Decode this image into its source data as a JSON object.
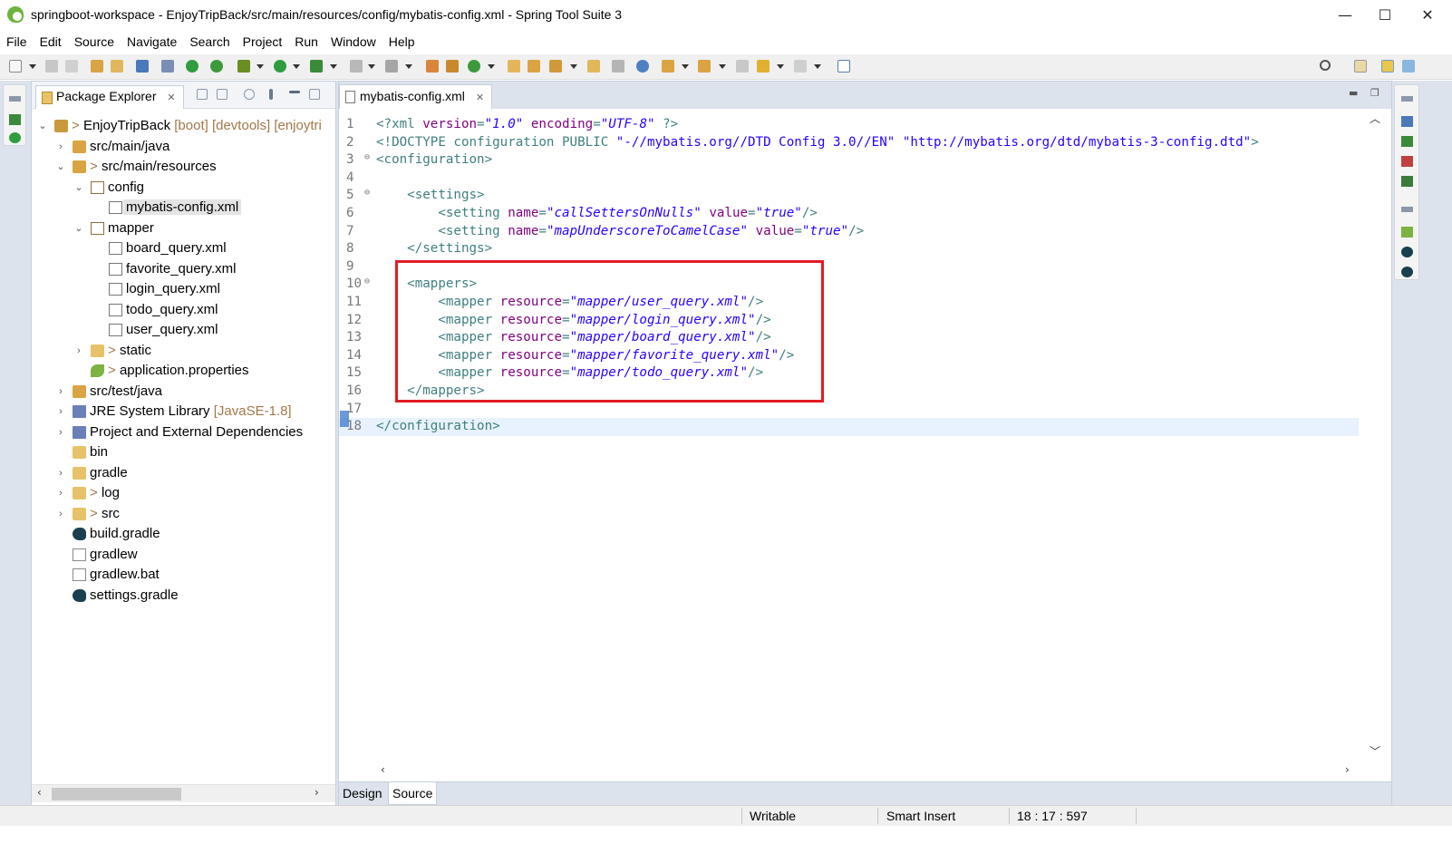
{
  "window": {
    "title": "springboot-workspace - EnjoyTripBack/src/main/resources/config/mybatis-config.xml - Spring Tool Suite 3",
    "minimize_glyph": "—",
    "maximize_glyph": "☐",
    "close_glyph": "✕"
  },
  "menu": [
    "File",
    "Edit",
    "Source",
    "Navigate",
    "Search",
    "Project",
    "Run",
    "Window",
    "Help"
  ],
  "explorer": {
    "title": "Package Explorer",
    "close_glyph": "✕",
    "tree": [
      {
        "label": "EnjoyTripBack",
        "decor": "[boot] [devtools] [enjoytri",
        "prefix": ">",
        "icon": "project-icon"
      },
      {
        "label": "src/main/java",
        "icon": "source-folder-icon"
      },
      {
        "label": "src/main/resources",
        "prefix": ">",
        "icon": "source-folder-icon"
      },
      {
        "label": "config",
        "icon": "package-icon"
      },
      {
        "label": "mybatis-config.xml",
        "icon": "xml-file-icon"
      },
      {
        "label": "mapper",
        "icon": "package-icon"
      },
      {
        "label": "board_query.xml",
        "icon": "xml-file-icon"
      },
      {
        "label": "favorite_query.xml",
        "icon": "xml-file-icon"
      },
      {
        "label": "login_query.xml",
        "icon": "xml-file-icon"
      },
      {
        "label": "todo_query.xml",
        "icon": "xml-file-icon"
      },
      {
        "label": "user_query.xml",
        "icon": "xml-file-icon"
      },
      {
        "label": "static",
        "prefix": ">",
        "icon": "folder-icon"
      },
      {
        "label": "application.properties",
        "prefix": ">",
        "icon": "properties-file-icon"
      },
      {
        "label": "src/test/java",
        "icon": "source-folder-icon"
      },
      {
        "label": "JRE System Library",
        "decor": "[JavaSE-1.8]",
        "icon": "library-icon"
      },
      {
        "label": "Project and External Dependencies",
        "icon": "library-icon"
      },
      {
        "label": "bin",
        "icon": "folder-icon"
      },
      {
        "label": "gradle",
        "icon": "folder-icon"
      },
      {
        "label": "log",
        "prefix": ">",
        "icon": "folder-icon"
      },
      {
        "label": "src",
        "prefix": ">",
        "icon": "folder-icon"
      },
      {
        "label": "build.gradle",
        "icon": "gradle-file-icon"
      },
      {
        "label": "gradlew",
        "icon": "file-icon"
      },
      {
        "label": "gradlew.bat",
        "icon": "file-icon"
      },
      {
        "label": "settings.gradle",
        "icon": "gradle-file-icon"
      }
    ]
  },
  "editor": {
    "tab_label": "mybatis-config.xml",
    "close_glyph": "✕",
    "line_numbers": [
      "1",
      "2",
      "3",
      "4",
      "5",
      "6",
      "7",
      "8",
      "9",
      "10",
      "11",
      "12",
      "13",
      "14",
      "15",
      "16",
      "17",
      "18"
    ],
    "lines": [
      [
        [
          "decl",
          "<?xml "
        ],
        [
          "attr",
          "version"
        ],
        [
          "decl",
          "="
        ],
        [
          "val",
          "\"1.0\""
        ],
        [
          "decl",
          " "
        ],
        [
          "attr",
          "encoding"
        ],
        [
          "decl",
          "="
        ],
        [
          "val",
          "\"UTF-8\""
        ],
        [
          "decl",
          " ?>"
        ]
      ],
      [
        [
          "decl",
          "<!DOCTYPE configuration "
        ],
        [
          "tag",
          "PUBLIC "
        ],
        [
          "str",
          "\"-//mybatis.org//DTD Config 3.0//EN\" \"http://mybatis.org/dtd/mybatis-3-config.dtd\""
        ],
        [
          "decl",
          ">"
        ]
      ],
      [
        [
          "tag",
          "<configuration>"
        ]
      ],
      [],
      [
        [
          "tag",
          "    <settings>"
        ]
      ],
      [
        [
          "tag",
          "        <setting "
        ],
        [
          "attr",
          "name"
        ],
        [
          "tag",
          "="
        ],
        [
          "val",
          "\"callSettersOnNulls\""
        ],
        [
          "tag",
          " "
        ],
        [
          "attr",
          "value"
        ],
        [
          "tag",
          "="
        ],
        [
          "val",
          "\"true\""
        ],
        [
          "tag",
          "/>"
        ]
      ],
      [
        [
          "tag",
          "        <setting "
        ],
        [
          "attr",
          "name"
        ],
        [
          "tag",
          "="
        ],
        [
          "val",
          "\"mapUnderscoreToCamelCase\""
        ],
        [
          "tag",
          " "
        ],
        [
          "attr",
          "value"
        ],
        [
          "tag",
          "="
        ],
        [
          "val",
          "\"true\""
        ],
        [
          "tag",
          "/>"
        ]
      ],
      [
        [
          "tag",
          "    </settings>"
        ]
      ],
      [],
      [
        [
          "tag",
          "    <mappers>"
        ]
      ],
      [
        [
          "tag",
          "        <mapper "
        ],
        [
          "attr",
          "resource"
        ],
        [
          "tag",
          "="
        ],
        [
          "val",
          "\"mapper/user_query.xml\""
        ],
        [
          "tag",
          "/>"
        ]
      ],
      [
        [
          "tag",
          "        <mapper "
        ],
        [
          "attr",
          "resource"
        ],
        [
          "tag",
          "="
        ],
        [
          "val",
          "\"mapper/login_query.xml\""
        ],
        [
          "tag",
          "/>"
        ]
      ],
      [
        [
          "tag",
          "        <mapper "
        ],
        [
          "attr",
          "resource"
        ],
        [
          "tag",
          "="
        ],
        [
          "val",
          "\"mapper/board_query.xml\""
        ],
        [
          "tag",
          "/>"
        ]
      ],
      [
        [
          "tag",
          "        <mapper "
        ],
        [
          "attr",
          "resource"
        ],
        [
          "tag",
          "="
        ],
        [
          "val",
          "\"mapper/favorite_query.xml\""
        ],
        [
          "tag",
          "/>"
        ]
      ],
      [
        [
          "tag",
          "        <mapper "
        ],
        [
          "attr",
          "resource"
        ],
        [
          "tag",
          "="
        ],
        [
          "val",
          "\"mapper/todo_query.xml\""
        ],
        [
          "tag",
          "/>"
        ]
      ],
      [
        [
          "tag",
          "    </mappers>"
        ]
      ],
      [],
      [
        [
          "tag",
          "</configuration>"
        ]
      ]
    ],
    "fold_lines": [
      3,
      5,
      10
    ],
    "current_line": 18,
    "bottom_tabs": [
      "Design",
      "Source"
    ],
    "active_bottom_tab": "Source",
    "highlight_color": "#e31b23"
  },
  "status": {
    "mode": "Writable",
    "insert_mode": "Smart Insert",
    "position": "18 : 17 : 597"
  },
  "colors": {
    "xml_tag": "#3f7f7f",
    "xml_attribute": "#7f007f",
    "xml_value": "#2a00ff",
    "workbench_bg": "#dde3ed"
  }
}
